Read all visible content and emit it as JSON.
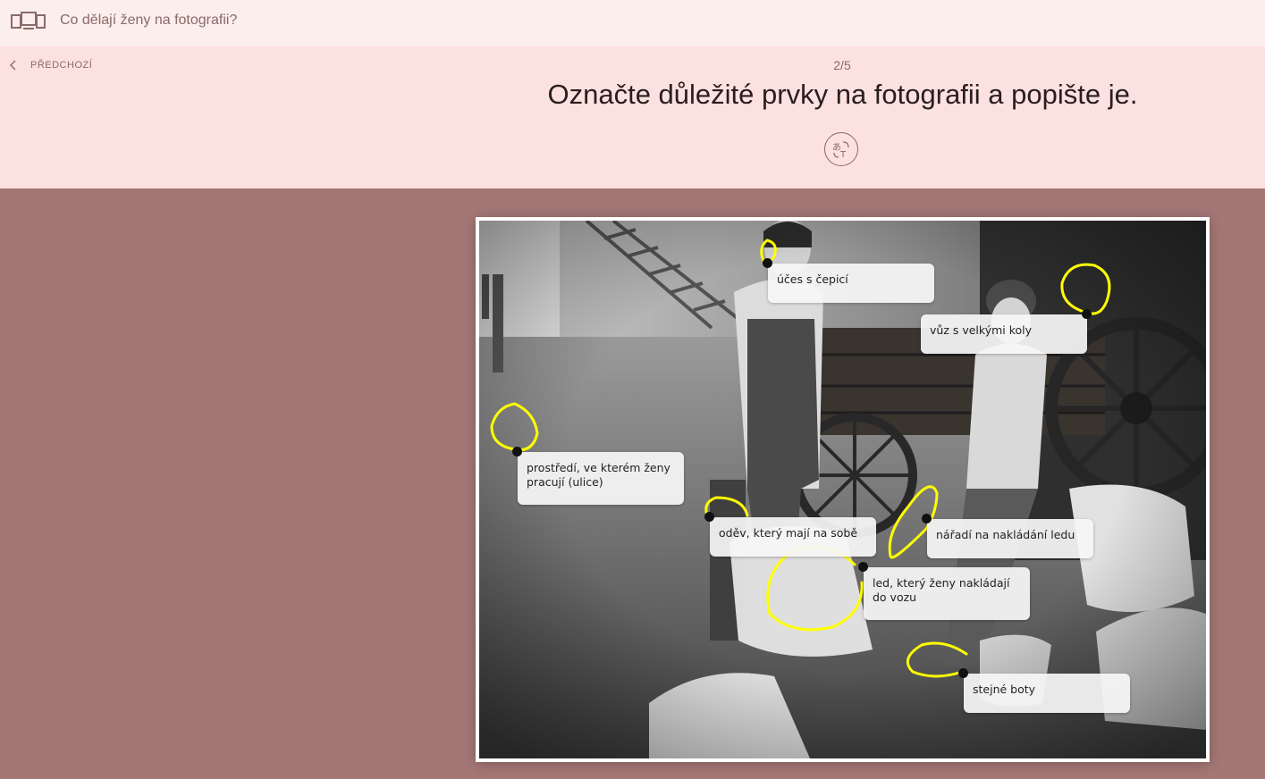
{
  "topbar": {
    "title": "Co dělají ženy na fotografii?",
    "icon": "devices-icon"
  },
  "header": {
    "prev_label": "PŘEDCHOZÍ",
    "counter": "2/5",
    "heading": "Označte důležité prvky na fotografii a popište je.",
    "translate_icon": "translate-icon"
  },
  "colors": {
    "topbar_bg": "#fbeeec",
    "header_bg": "#fbe1df",
    "page_bg": "#a47776",
    "highlight": "#ffff00",
    "text_muted": "#8b6a68"
  },
  "annotations": [
    {
      "text": "účes s čepicí"
    },
    {
      "text": "vůz s velkými koly"
    },
    {
      "text": "prostředí, ve kterém ženy pracují (ulice)"
    },
    {
      "text": "oděv, který mají na sobě"
    },
    {
      "text": "nářadí na nakládání ledu"
    },
    {
      "text": "led, který ženy nakládají do vozu"
    },
    {
      "text": "stejné boty"
    }
  ]
}
